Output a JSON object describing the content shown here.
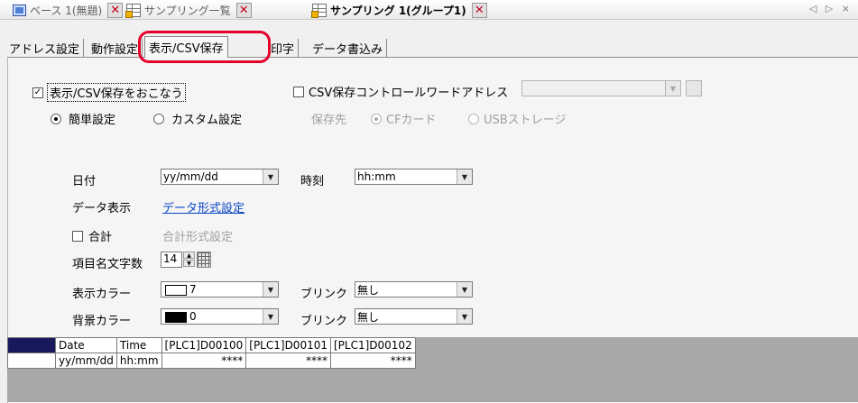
{
  "doc_tabs": [
    {
      "label": "ベース 1(無題)"
    },
    {
      "label": "サンプリング一覧"
    },
    {
      "label": "サンプリング 1(グループ1)"
    }
  ],
  "doc_nav": "◁ ▷ ×",
  "settings_tabs": [
    {
      "label": "アドレス設定"
    },
    {
      "label": "動作設定"
    },
    {
      "label": "表示/CSV保存"
    },
    {
      "label": "印字"
    },
    {
      "label": "データ書込み"
    }
  ],
  "display_csv": {
    "label": "表示/CSV保存をおこなう",
    "checked": true
  },
  "csv_control": {
    "label": "CSV保存コントロールワードアドレス",
    "checked": false
  },
  "setting_mode": {
    "simple": "簡単設定",
    "custom": "カスタム設定",
    "selected": "simple"
  },
  "save_dest": {
    "label": "保存先",
    "cf": "CFカード",
    "usb": "USBストレージ"
  },
  "date": {
    "label": "日付",
    "value": "yy/mm/dd"
  },
  "time": {
    "label": "時刻",
    "value": "hh:mm"
  },
  "data_display": {
    "label": "データ表示",
    "link": "データ形式設定"
  },
  "total": {
    "label": "合計",
    "link": "合計形式設定",
    "checked": false
  },
  "item_chars": {
    "label": "項目名文字数",
    "value": "14"
  },
  "display_color": {
    "label": "表示カラー",
    "value": "7",
    "swatch": "#ffffff",
    "blink_label": "ブリンク",
    "blink_value": "無し"
  },
  "bg_color": {
    "label": "背景カラー",
    "value": "0",
    "swatch": "#000000",
    "blink_label": "ブリンク",
    "blink_value": "無し"
  },
  "preview": {
    "headers": [
      "Date",
      "Time",
      "[PLC1]D00100",
      "[PLC1]D00101",
      "[PLC1]D00102"
    ],
    "row": [
      "yy/mm/dd",
      "hh:mm",
      "****",
      "****",
      "****"
    ],
    "header_color": "#17195c"
  }
}
